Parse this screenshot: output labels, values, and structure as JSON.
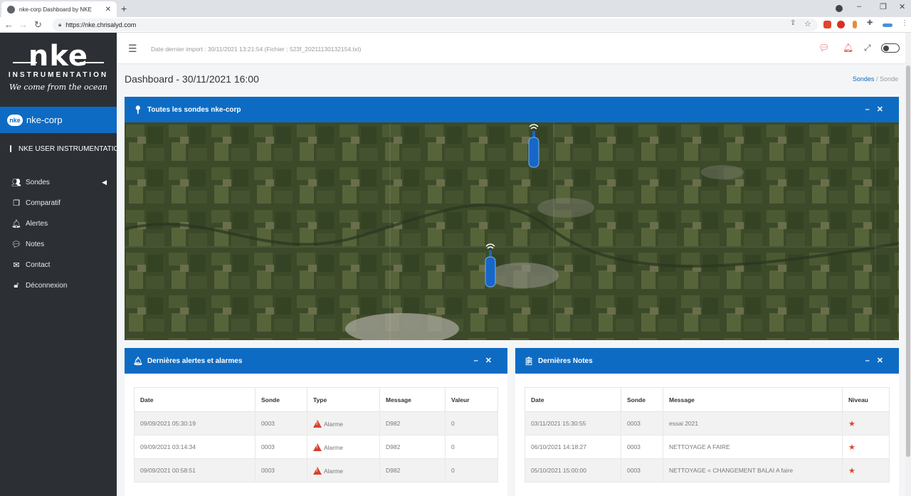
{
  "browser": {
    "tab_title": "nke-corp Dashboard by NKE",
    "url": "https://nke.chrisalyd.com"
  },
  "sidebar": {
    "logo_text": "nke",
    "logo_subtitle": "INSTRUMENTATION",
    "logo_tagline": "We come from the ocean",
    "company_badge": "nke",
    "company": "nke-corp",
    "user": "NKE USER INSTRUMENTATION",
    "menu": [
      {
        "label": "Sondes",
        "icon": "users-icon"
      },
      {
        "label": "Comparatif",
        "icon": "copy-icon"
      },
      {
        "label": "Alertes",
        "icon": "bell-icon"
      },
      {
        "label": "Notes",
        "icon": "comments-icon"
      },
      {
        "label": "Contact",
        "icon": "envelope-icon"
      },
      {
        "label": "Déconnexion",
        "icon": "unlock-icon"
      }
    ]
  },
  "topbar": {
    "import_info": "Date dernier import : 30/11/2021 13:21:54 (Fichier : 523f_20211130132154.txt)"
  },
  "page": {
    "title": "Dashboard - 30/11/2021 16:00",
    "breadcrumb": [
      "Sondes",
      "Sonde"
    ]
  },
  "map_card": {
    "title": "Toutes les sondes nke-corp"
  },
  "alerts_card": {
    "title": "Dernières alertes et alarmes",
    "columns": [
      "Date",
      "Sonde",
      "Type",
      "Message",
      "Valeur"
    ],
    "rows": [
      [
        "09/09/2021 05:30:19",
        "0003",
        "Alarme",
        "D982",
        "0"
      ],
      [
        "09/09/2021 03:14:34",
        "0003",
        "Alarme",
        "D982",
        "0"
      ],
      [
        "09/09/2021 00:58:51",
        "0003",
        "Alarme",
        "D982",
        "0"
      ]
    ]
  },
  "notes_card": {
    "title": "Dernières Notes",
    "columns": [
      "Date",
      "Sonde",
      "Message",
      "Niveau"
    ],
    "rows": [
      [
        "03/11/2021 15:30:55",
        "0003",
        "essai 2021",
        "★"
      ],
      [
        "06/10/2021 14:18:27",
        "0003",
        "NETTOYAGE A FAIRE",
        "★"
      ],
      [
        "05/10/2021 15:00:00",
        "0003",
        "NETTOYAGE = CHANGEMENT BALAI A faire",
        "★"
      ]
    ]
  },
  "colors": {
    "accent": "#0e6bc3",
    "sidebar": "#2c3035",
    "alarm": "#d9422e"
  }
}
